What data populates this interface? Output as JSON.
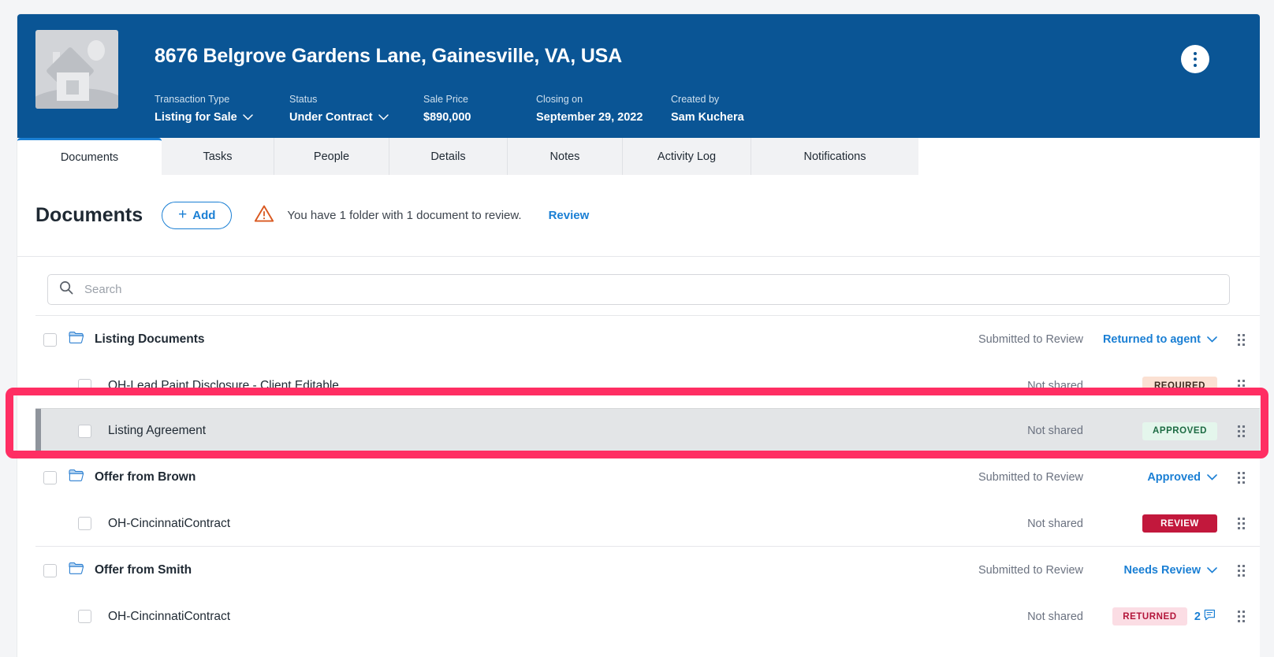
{
  "header": {
    "title": "8676 Belgrove Gardens Lane, Gainesville, VA, USA",
    "thumbnail_icon": "house-placeholder-icon",
    "kebab_icon": "more-options-icon",
    "meta": [
      {
        "label": "Transaction Type",
        "value": "Listing for Sale",
        "has_dropdown": true
      },
      {
        "label": "Status",
        "value": "Under Contract",
        "has_dropdown": true
      },
      {
        "label": "Sale Price",
        "value": "$890,000",
        "has_dropdown": false
      },
      {
        "label": "Closing on",
        "value": "September 29, 2022",
        "has_dropdown": false
      },
      {
        "label": "Created by",
        "value": "Sam Kuchera",
        "has_dropdown": false
      }
    ]
  },
  "tabs": [
    {
      "label": "Documents",
      "active": true
    },
    {
      "label": "Tasks",
      "active": false
    },
    {
      "label": "People",
      "active": false
    },
    {
      "label": "Details",
      "active": false
    },
    {
      "label": "Notes",
      "active": false
    },
    {
      "label": "Activity Log",
      "active": false
    },
    {
      "label": "Notifications",
      "active": false
    }
  ],
  "toolbar": {
    "title": "Documents",
    "add_label": "Add",
    "add_icon": "plus-icon",
    "warning_icon": "warning-triangle-icon",
    "warning_text": "You have 1 folder with 1 document to review.",
    "review_link": "Review"
  },
  "search": {
    "icon": "search-icon",
    "placeholder": "Search",
    "value": ""
  },
  "rows": [
    {
      "type": "folder",
      "name": "Listing Documents",
      "icon": "folder-open-icon",
      "shared": "Submitted to Review",
      "status": "Returned to agent",
      "drag_icon": "drag-handle-icon"
    },
    {
      "type": "doc",
      "name": "OH-Lead Paint Disclosure - Client Editable",
      "shared": "Not shared",
      "badge": "REQUIRED",
      "badge_style": "required",
      "drag_icon": "drag-handle-icon"
    },
    {
      "type": "doc",
      "name": "Listing Agreement",
      "shared": "Not shared",
      "badge": "APPROVED",
      "badge_style": "approved",
      "selected": true,
      "drag_icon": "drag-handle-icon"
    },
    {
      "type": "folder",
      "name": "Offer from Brown",
      "icon": "folder-open-icon",
      "shared": "Submitted to Review",
      "status": "Approved",
      "drag_icon": "drag-handle-icon"
    },
    {
      "type": "doc",
      "name": "OH-CincinnatiContract",
      "shared": "Not shared",
      "badge": "REVIEW",
      "badge_style": "review",
      "drag_icon": "drag-handle-icon"
    },
    {
      "type": "folder",
      "name": "Offer from Smith",
      "icon": "folder-open-icon",
      "shared": "Submitted to Review",
      "status": "Needs Review",
      "drag_icon": "drag-handle-icon"
    },
    {
      "type": "doc",
      "name": "OH-CincinnatiContract",
      "shared": "Not shared",
      "badge": "RETURNED",
      "badge_style": "returned",
      "comment_count": "2",
      "comment_icon": "comment-icon",
      "drag_icon": "drag-handle-icon"
    }
  ],
  "colors": {
    "header_blue": "#0a5595",
    "link_blue": "#1a7fd4",
    "highlight_pink": "#ff2e63",
    "badge_review_red": "#c2183c",
    "badge_approved_green": "#1d6b43",
    "badge_returned_red": "#b3153a"
  }
}
